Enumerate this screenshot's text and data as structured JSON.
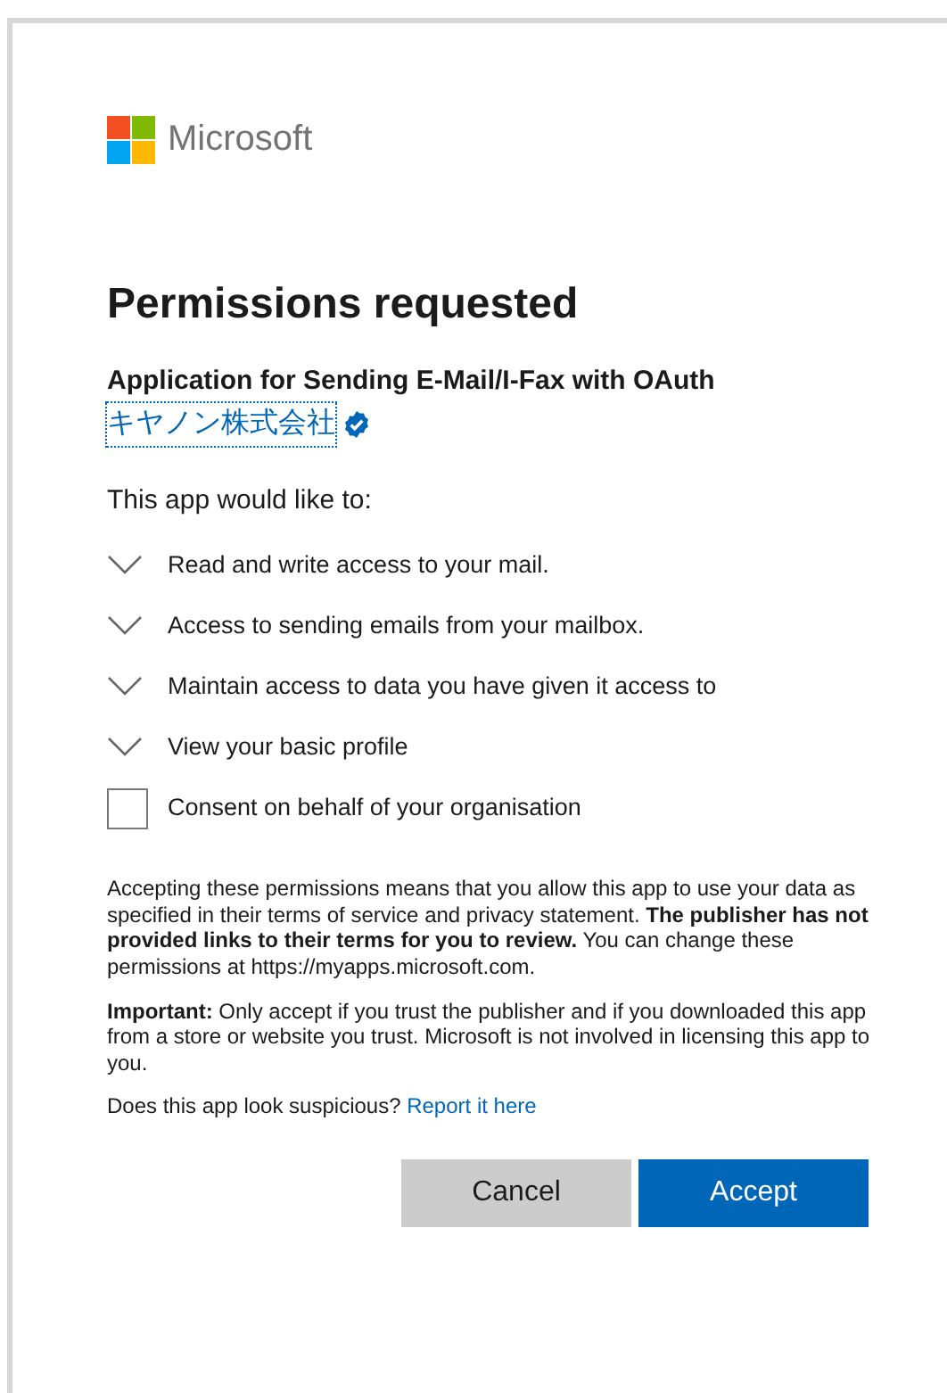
{
  "brand": {
    "name": "Microsoft"
  },
  "title": "Permissions requested",
  "app_name": "Application for Sending E-Mail/I-Fax with OAuth",
  "publisher": {
    "name": "キヤノン株式会社",
    "verified": true
  },
  "intro": "This app would like to:",
  "permissions": [
    {
      "label": "Read and write access to your mail.",
      "expanded": false
    },
    {
      "label": "Access to sending emails from your mailbox.",
      "expanded": false
    },
    {
      "label": "Maintain access to data you have given it access to",
      "expanded": false
    },
    {
      "label": "View your basic profile",
      "expanded": false
    }
  ],
  "consent": {
    "label": "Consent on behalf of your organisation",
    "checked": false
  },
  "notices": [
    "Accepting these permissions means that you allow this app to use your data as specified in their terms of service and privacy statement. **The publisher has not provided links to their terms for you to review.** You can change these permissions at https://myapps.microsoft.com.",
    "**Important:** Only accept if you trust the publisher and if you downloaded this app from a store or website you trust. Microsoft is not involved in licensing this app to you."
  ],
  "suspicious": {
    "text": "Does this app look suspicious?",
    "link": "Report it here"
  },
  "buttons": [
    {
      "label": "Cancel",
      "kind": "secondary"
    },
    {
      "label": "Accept",
      "kind": "primary"
    }
  ]
}
